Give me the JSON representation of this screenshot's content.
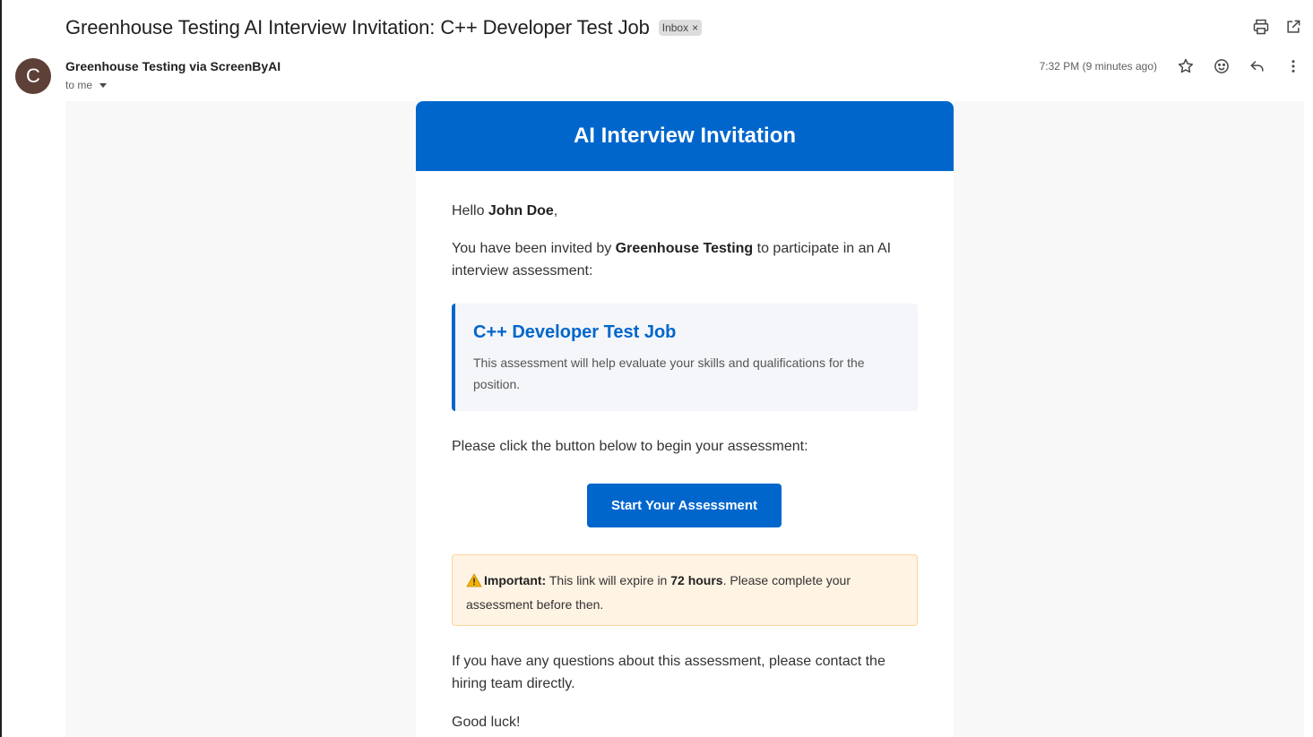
{
  "email": {
    "subject": "Greenhouse Testing AI Interview Invitation: C++ Developer Test Job",
    "label": "Inbox",
    "label_remove": "×",
    "sender": {
      "avatar_letter": "C",
      "name": "Greenhouse Testing via ScreenByAI",
      "recipient": "to me"
    },
    "timestamp": "7:32 PM (9 minutes ago)",
    "top_icons": [
      "print-icon",
      "open-in-new-window-icon"
    ],
    "meta_icons": [
      "star-icon",
      "emoji-reaction-icon",
      "reply-icon",
      "more-vert-icon"
    ]
  },
  "body": {
    "header_title": "AI Interview Invitation",
    "greeting_prefix": "Hello ",
    "greeting_name": "John Doe",
    "greeting_suffix": ",",
    "invite_prefix": "You have been invited by ",
    "invite_company": "Greenhouse Testing",
    "invite_suffix": " to participate in an AI interview assessment:",
    "job": {
      "title": "C++ Developer Test Job",
      "description": "This assessment will help evaluate your skills and qualifications for the position."
    },
    "instruction": "Please click the button below to begin your assessment:",
    "cta_label": "Start Your Assessment",
    "notice": {
      "label": "Important:",
      "text_before": " This link will expire in ",
      "duration": "72 hours",
      "text_after": ". Please complete your assessment before then."
    },
    "questions": "If you have any questions about this assessment, please contact the hiring team directly.",
    "closing": "Good luck!"
  },
  "colors": {
    "brand_blue": "#0066cc",
    "avatar": "#5d4037",
    "notice_bg": "#fff3e3",
    "notice_border": "#ffd49a"
  }
}
